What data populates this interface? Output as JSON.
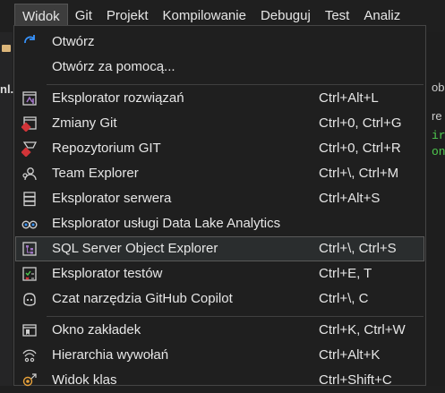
{
  "menubar": {
    "items": [
      "Widok",
      "Git",
      "Projekt",
      "Kompilowanie",
      "Debuguj",
      "Test",
      "Analiz"
    ]
  },
  "background": {
    "left_tab": "nl.",
    "right_text_1": "obi",
    "right_text_2": "re",
    "right_code_1": "ir",
    "right_code_2": "on"
  },
  "menu": {
    "items": [
      {
        "label": "Otwórz",
        "shortcut": "",
        "icon": "open-icon"
      },
      {
        "label": "Otwórz za pomocą...",
        "shortcut": "",
        "icon": ""
      },
      {
        "label": "Eksplorator rozwiązań",
        "shortcut": "Ctrl+Alt+L",
        "icon": "solution-explorer-icon"
      },
      {
        "label": "Zmiany Git",
        "shortcut": "Ctrl+0, Ctrl+G",
        "icon": "git-changes-icon"
      },
      {
        "label": "Repozytorium GIT",
        "shortcut": "Ctrl+0, Ctrl+R",
        "icon": "git-repository-icon"
      },
      {
        "label": "Team Explorer",
        "shortcut": "Ctrl+\\, Ctrl+M",
        "icon": "team-explorer-icon"
      },
      {
        "label": "Eksplorator serwera",
        "shortcut": "Ctrl+Alt+S",
        "icon": "server-explorer-icon"
      },
      {
        "label": "Eksplorator usługi Data Lake Analytics",
        "shortcut": "",
        "icon": "data-lake-icon"
      },
      {
        "label": "SQL Server Object Explorer",
        "shortcut": "Ctrl+\\, Ctrl+S",
        "icon": "sql-object-explorer-icon"
      },
      {
        "label": "Eksplorator testów",
        "shortcut": "Ctrl+E, T",
        "icon": "test-explorer-icon"
      },
      {
        "label": "Czat narzędzia GitHub Copilot",
        "shortcut": "Ctrl+\\, C",
        "icon": "copilot-icon"
      },
      {
        "label": "Okno zakładek",
        "shortcut": "Ctrl+K, Ctrl+W",
        "icon": "bookmark-window-icon"
      },
      {
        "label": "Hierarchia wywołań",
        "shortcut": "Ctrl+Alt+K",
        "icon": "call-hierarchy-icon"
      },
      {
        "label": "Widok klas",
        "shortcut": "Ctrl+Shift+C",
        "icon": "class-view-icon"
      }
    ]
  },
  "colors": {
    "background": "#1f1f1f",
    "highlight": "#2a2d2e",
    "separator": "#3f3f3f",
    "accent_red": "#d13438",
    "accent_purple": "#a074c4",
    "accent_blue": "#3794ff"
  }
}
